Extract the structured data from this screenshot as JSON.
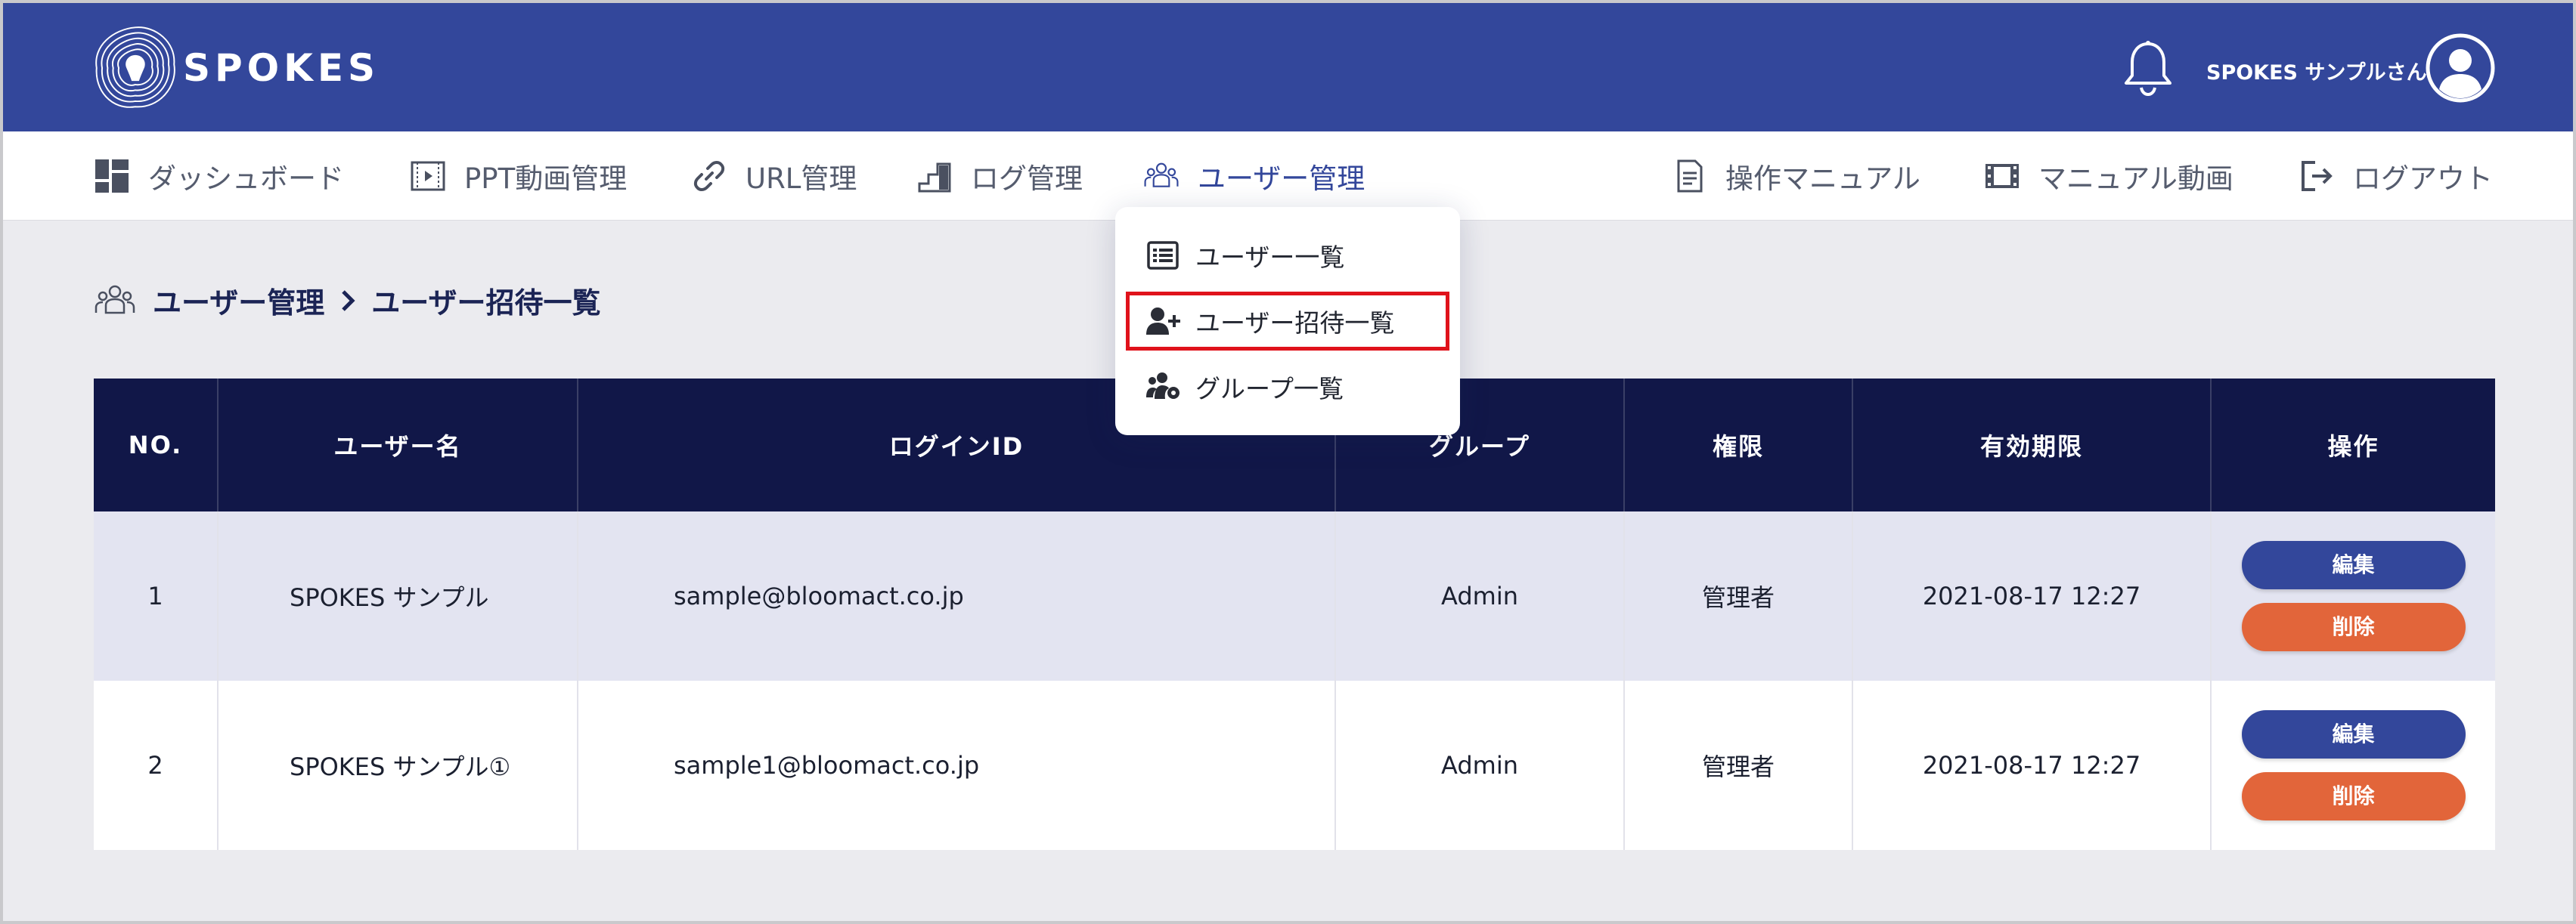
{
  "header": {
    "logo_text": "SPOKES",
    "user_name": "SPOKES サンプルさん"
  },
  "nav": {
    "dashboard": "ダッシュボード",
    "ppt_video": "PPT動画管理",
    "url_manage": "URL管理",
    "log_manage": "ログ管理",
    "user_manage": "ユーザー管理",
    "manual": "操作マニュアル",
    "manual_video": "マニュアル動画",
    "logout": "ログアウト"
  },
  "dropdown": {
    "user_list": "ユーザー一覧",
    "user_invite_list": "ユーザー招待一覧",
    "group_list": "グループ一覧"
  },
  "breadcrumb": {
    "parent": "ユーザー管理",
    "current": "ユーザー招待一覧"
  },
  "table": {
    "headers": [
      "NO.",
      "ユーザー名",
      "ログインID",
      "グループ",
      "権限",
      "有効期限",
      "操作"
    ],
    "rows": [
      {
        "no": "1",
        "username": "SPOKES サンプル",
        "login_id": "sample@bloomact.co.jp",
        "group": "Admin",
        "role": "管理者",
        "expires": "2021-08-17 12:27",
        "edit": "編集",
        "delete": "削除"
      },
      {
        "no": "2",
        "username": "SPOKES サンプル①",
        "login_id": "sample1@bloomact.co.jp",
        "group": "Admin",
        "role": "管理者",
        "expires": "2021-08-17 12:27",
        "edit": "編集",
        "delete": "削除"
      }
    ]
  },
  "colors": {
    "header_bg": "#33479b",
    "table_header_bg": "#111748",
    "edit_button": "#33479b",
    "delete_button": "#e2653a",
    "highlight": "#e0121b"
  }
}
